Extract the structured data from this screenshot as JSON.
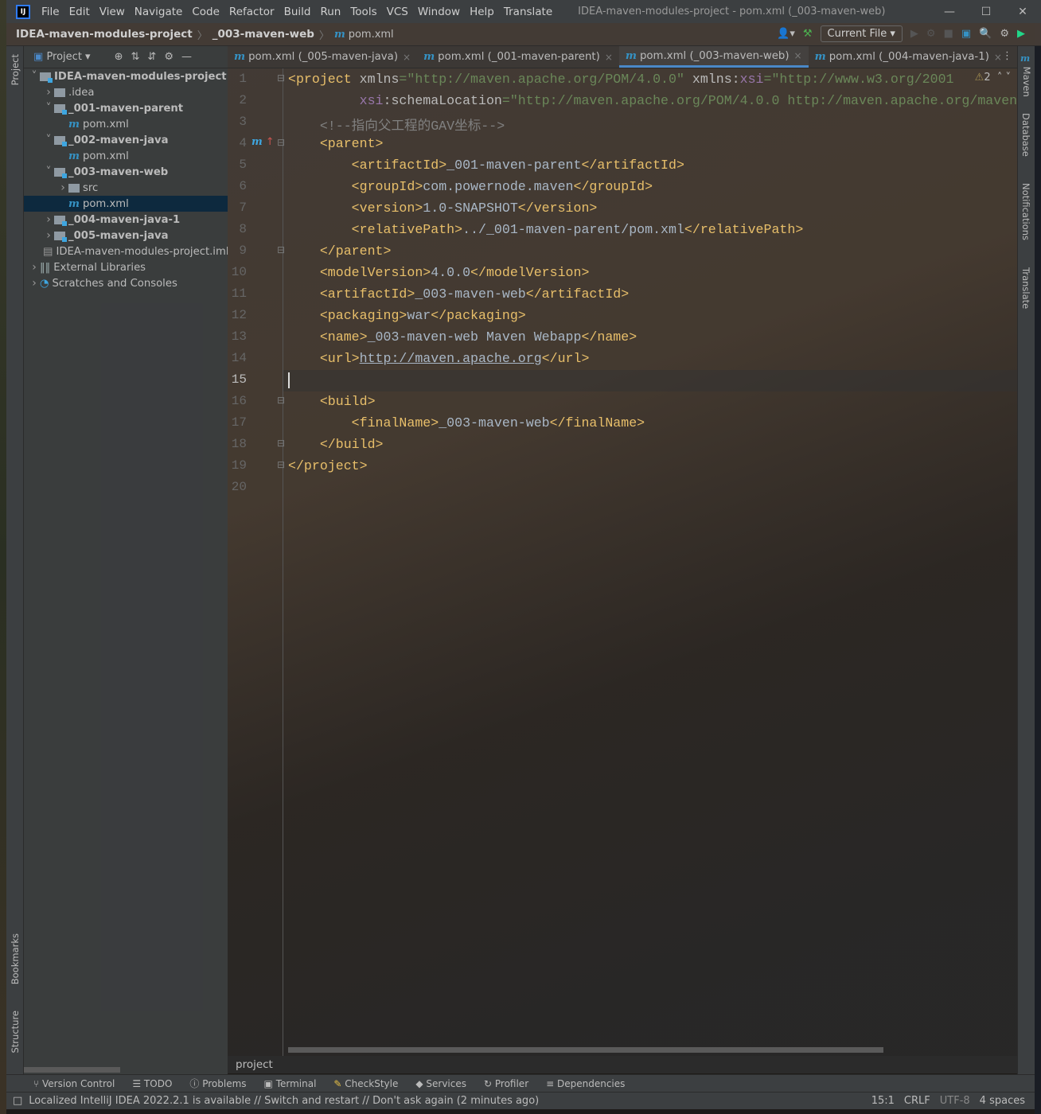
{
  "titlebar": {
    "menu": [
      "File",
      "Edit",
      "View",
      "Navigate",
      "Code",
      "Refactor",
      "Build",
      "Run",
      "Tools",
      "VCS",
      "Window",
      "Help",
      "Translate"
    ],
    "title": "IDEA-maven-modules-project - pom.xml (_003-maven-web)",
    "logo": "IJ"
  },
  "navbar": {
    "crumbs": [
      "IDEA-maven-modules-project",
      "_003-maven-web",
      "pom.xml"
    ],
    "run_config": "Current File"
  },
  "project_panel": {
    "title": "Project",
    "tree": [
      {
        "label": "IDEA-maven-modules-project",
        "level": 0,
        "arrow": "v",
        "icon": "module-folder",
        "bold": true
      },
      {
        "label": ".idea",
        "level": 1,
        "arrow": ">",
        "icon": "folder"
      },
      {
        "label": "_001-maven-parent",
        "level": 1,
        "arrow": "v",
        "icon": "module-folder",
        "bold": true
      },
      {
        "label": "pom.xml",
        "level": 2,
        "arrow": "",
        "icon": "maven"
      },
      {
        "label": "_002-maven-java",
        "level": 1,
        "arrow": "v",
        "icon": "module-folder",
        "bold": true
      },
      {
        "label": "pom.xml",
        "level": 2,
        "arrow": "",
        "icon": "maven"
      },
      {
        "label": "_003-maven-web",
        "level": 1,
        "arrow": "v",
        "icon": "module-folder",
        "bold": true
      },
      {
        "label": "src",
        "level": 2,
        "arrow": ">",
        "icon": "folder"
      },
      {
        "label": "pom.xml",
        "level": 2,
        "arrow": "",
        "icon": "maven",
        "selected": true
      },
      {
        "label": "_004-maven-java-1",
        "level": 1,
        "arrow": ">",
        "icon": "module-folder",
        "bold": true
      },
      {
        "label": "_005-maven-java",
        "level": 1,
        "arrow": ">",
        "icon": "module-folder",
        "bold": true
      },
      {
        "label": "IDEA-maven-modules-project.iml",
        "level": 1,
        "arrow": "",
        "icon": "iml-file"
      },
      {
        "label": "External Libraries",
        "level": 0,
        "arrow": ">",
        "icon": "libraries"
      },
      {
        "label": "Scratches and Consoles",
        "level": 0,
        "arrow": ">",
        "icon": "scratches"
      }
    ]
  },
  "editor_tabs": [
    {
      "label": "pom.xml (_005-maven-java)",
      "active": false
    },
    {
      "label": "pom.xml (_001-maven-parent)",
      "active": false
    },
    {
      "label": "pom.xml (_003-maven-web)",
      "active": true
    },
    {
      "label": "pom.xml (_004-maven-java-1)",
      "active": false
    }
  ],
  "editor": {
    "warnings": "2",
    "current_line": 15,
    "lines": [
      [
        [
          "tag",
          "<project "
        ],
        [
          "attr",
          "xmlns"
        ],
        [
          "str",
          "=\"http://maven.apache.org/POM/4.0.0\" "
        ],
        [
          "attr",
          "xmlns:"
        ],
        [
          "ns",
          "xsi"
        ],
        [
          "str",
          "=\"http://www.w3.org/2001"
        ]
      ],
      [
        [
          "text",
          "         "
        ],
        [
          "ns",
          "xsi"
        ],
        [
          "attr",
          ":schemaLocation"
        ],
        [
          "str",
          "=\"http://maven.apache.org/POM/4.0.0 http://maven.apache.org/maven"
        ]
      ],
      [
        [
          "com",
          "    <!--指向父工程的GAV坐标-->"
        ]
      ],
      [
        [
          "tag",
          "    <parent>"
        ]
      ],
      [
        [
          "tag",
          "        <artifactId>"
        ],
        [
          "text",
          "_001-maven-parent"
        ],
        [
          "tag",
          "</artifactId>"
        ]
      ],
      [
        [
          "tag",
          "        <groupId>"
        ],
        [
          "text",
          "com.powernode.maven"
        ],
        [
          "tag",
          "</groupId>"
        ]
      ],
      [
        [
          "tag",
          "        <version>"
        ],
        [
          "text",
          "1.0-SNAPSHOT"
        ],
        [
          "tag",
          "</version>"
        ]
      ],
      [
        [
          "tag",
          "        <relativePath>"
        ],
        [
          "text",
          "../_001-maven-parent/pom.xml"
        ],
        [
          "tag",
          "</relativePath>"
        ]
      ],
      [
        [
          "tag",
          "    </parent>"
        ]
      ],
      [
        [
          "tag",
          "    <modelVersion>"
        ],
        [
          "text",
          "4.0.0"
        ],
        [
          "tag",
          "</modelVersion>"
        ]
      ],
      [
        [
          "tag",
          "    <artifactId>"
        ],
        [
          "text",
          "_003-maven-web"
        ],
        [
          "tag",
          "</artifactId>"
        ]
      ],
      [
        [
          "tag",
          "    <packaging>"
        ],
        [
          "text",
          "war"
        ],
        [
          "tag",
          "</packaging>"
        ]
      ],
      [
        [
          "tag",
          "    <name>"
        ],
        [
          "text",
          "_003-maven-web Maven Webapp"
        ],
        [
          "tag",
          "</name>"
        ]
      ],
      [
        [
          "tag",
          "    <url>"
        ],
        [
          "url",
          "http://maven.apache.org"
        ],
        [
          "tag",
          "</url>"
        ]
      ],
      [],
      [
        [
          "tag",
          "    <build>"
        ]
      ],
      [
        [
          "tag",
          "        <finalName>"
        ],
        [
          "text",
          "_003-maven-web"
        ],
        [
          "tag",
          "</finalName>"
        ]
      ],
      [
        [
          "tag",
          "    </build>"
        ]
      ],
      [
        [
          "tag",
          "</project>"
        ]
      ],
      []
    ]
  },
  "editor_breadcrumb": "project",
  "left_stripe": {
    "top": "Project",
    "bottom": [
      "Bookmarks",
      "Structure"
    ]
  },
  "right_stripe": [
    "Maven",
    "Database",
    "Notifications",
    "Translate"
  ],
  "tool_windows": [
    "Version Control",
    "TODO",
    "Problems",
    "Terminal",
    "CheckStyle",
    "Services",
    "Profiler",
    "Dependencies"
  ],
  "status": {
    "message": "Localized IntelliJ IDEA 2022.2.1 is available // Switch and restart // Don't ask again (2 minutes ago)",
    "position": "15:1",
    "line_sep": "CRLF",
    "encoding": "UTF-8",
    "indent": "4 spaces"
  },
  "colors": {
    "tag": "#e8bf6a",
    "string": "#6a8759",
    "namespace": "#9876aa",
    "comment": "#808080",
    "accent": "#4a88c7",
    "maven": "#3592c4"
  }
}
